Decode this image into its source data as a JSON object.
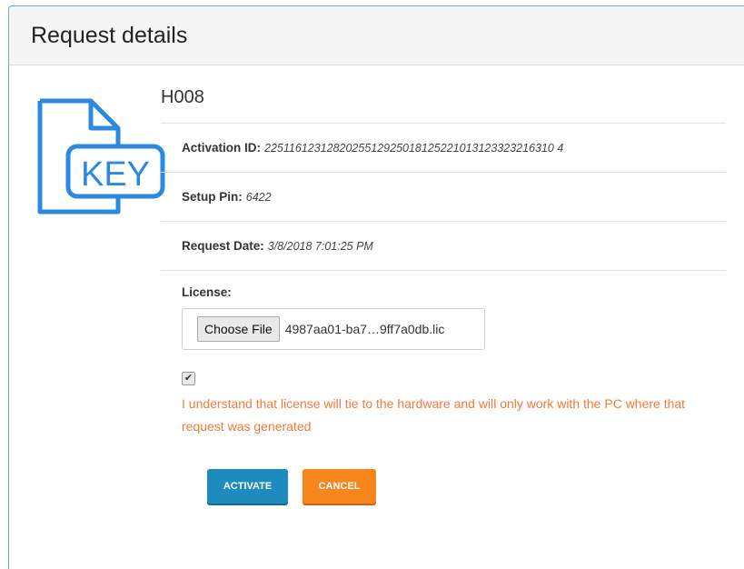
{
  "header": {
    "title": "Request details"
  },
  "icon": {
    "name": "key-file-icon",
    "text": "KEY",
    "color": "#2b8ae0"
  },
  "request": {
    "name": "H008",
    "activation_label": "Activation ID:",
    "activation_value": "2251161231282025512925018125221013123323216310 4",
    "setup_label": "Setup Pin:",
    "setup_value": "6422",
    "date_label": "Request Date:",
    "date_value": "3/8/2018 7:01:25 PM"
  },
  "license": {
    "label": "License:",
    "choose_label": "Choose File",
    "file_name": "4987aa01-ba7…9ff7a0db.lic",
    "checked_mark": "✔",
    "warning": "I understand that license will tie to the hardware and will only work with the PC where that request was generated"
  },
  "actions": {
    "activate_label": "ACTIVATE",
    "cancel_label": "CANCEL"
  },
  "colors": {
    "accent": "#1e8bbf",
    "cancel": "#f7861d",
    "warning": "#f07a3c"
  }
}
